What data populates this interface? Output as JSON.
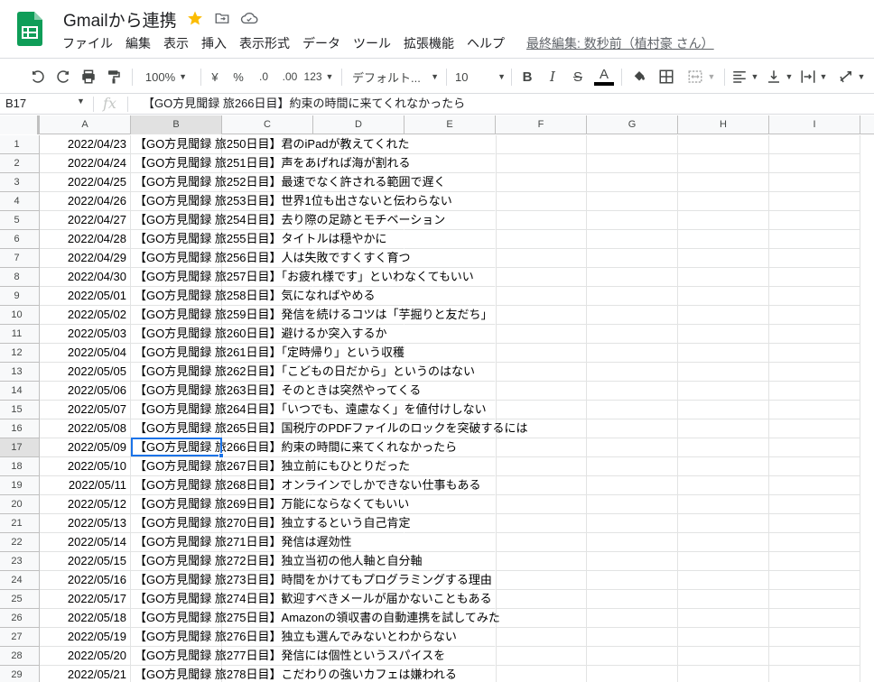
{
  "app": {
    "title": "Gmailから連携",
    "last_edit": "最終編集: 数秒前（植村豪 さん）",
    "brand_color": "#0f9d58"
  },
  "menu": [
    "ファイル",
    "編集",
    "表示",
    "挿入",
    "表示形式",
    "データ",
    "ツール",
    "拡張機能",
    "ヘルプ"
  ],
  "toolbar": {
    "zoom": "100%",
    "currency": "¥",
    "percent": "%",
    "decimal_decrease": ".0",
    "decimal_increase": ".00",
    "more_formats": "123",
    "font": "デフォルト...",
    "font_size": "10",
    "bold": "B",
    "italic": "I",
    "strikethrough": "S",
    "text_color_glyph": "A"
  },
  "formula_bar": {
    "cell_ref": "B17",
    "fx": "fx",
    "content": "【GO方見聞録 旅266日目】約束の時間に来てくれなかったら"
  },
  "columns": [
    "A",
    "B",
    "C",
    "D",
    "E",
    "F",
    "G",
    "H",
    "I"
  ],
  "selected_column": "B",
  "selected_row": 17,
  "rows": [
    {
      "n": "1",
      "a": "2022/04/23",
      "b": "【GO方見聞録 旅250日目】君のiPadが教えてくれた"
    },
    {
      "n": "2",
      "a": "2022/04/24",
      "b": "【GO方見聞録 旅251日目】声をあげれば海が割れる"
    },
    {
      "n": "3",
      "a": "2022/04/25",
      "b": "【GO方見聞録 旅252日目】最速でなく許される範囲で遅く"
    },
    {
      "n": "4",
      "a": "2022/04/26",
      "b": "【GO方見聞録 旅253日目】世界1位も出さないと伝わらない"
    },
    {
      "n": "5",
      "a": "2022/04/27",
      "b": "【GO方見聞録 旅254日目】去り際の足跡とモチベーション"
    },
    {
      "n": "6",
      "a": "2022/04/28",
      "b": "【GO方見聞録 旅255日目】タイトルは穏やかに"
    },
    {
      "n": "7",
      "a": "2022/04/29",
      "b": "【GO方見聞録 旅256日目】人は失敗ですくすく育つ"
    },
    {
      "n": "8",
      "a": "2022/04/30",
      "b": "【GO方見聞録 旅257日目】「お疲れ様です」といわなくてもいい"
    },
    {
      "n": "9",
      "a": "2022/05/01",
      "b": "【GO方見聞録 旅258日目】気になればやめる"
    },
    {
      "n": "10",
      "a": "2022/05/02",
      "b": "【GO方見聞録 旅259日目】発信を続けるコツは「芋掘りと友だち」"
    },
    {
      "n": "11",
      "a": "2022/05/03",
      "b": "【GO方見聞録 旅260日目】避けるか突入するか"
    },
    {
      "n": "12",
      "a": "2022/05/04",
      "b": "【GO方見聞録 旅261日目】「定時帰り」という収穫"
    },
    {
      "n": "13",
      "a": "2022/05/05",
      "b": "【GO方見聞録 旅262日目】「こどもの日だから」というのはない"
    },
    {
      "n": "14",
      "a": "2022/05/06",
      "b": "【GO方見聞録 旅263日目】そのときは突然やってくる"
    },
    {
      "n": "15",
      "a": "2022/05/07",
      "b": "【GO方見聞録 旅264日目】「いつでも、遠慮なく」を値付けしない"
    },
    {
      "n": "16",
      "a": "2022/05/08",
      "b": "【GO方見聞録 旅265日目】国税庁のPDFファイルのロックを突破するには"
    },
    {
      "n": "17",
      "a": "2022/05/09",
      "b": "【GO方見聞録 旅266日目】約束の時間に来てくれなかったら"
    },
    {
      "n": "18",
      "a": "2022/05/10",
      "b": "【GO方見聞録 旅267日目】独立前にもひとりだった"
    },
    {
      "n": "19",
      "a": "2022/05/11",
      "b": "【GO方見聞録 旅268日目】オンラインでしかできない仕事もある"
    },
    {
      "n": "20",
      "a": "2022/05/12",
      "b": "【GO方見聞録 旅269日目】万能にならなくてもいい"
    },
    {
      "n": "21",
      "a": "2022/05/13",
      "b": "【GO方見聞録 旅270日目】独立するという自己肯定"
    },
    {
      "n": "22",
      "a": "2022/05/14",
      "b": "【GO方見聞録 旅271日目】発信は遅効性"
    },
    {
      "n": "23",
      "a": "2022/05/15",
      "b": "【GO方見聞録 旅272日目】独立当初の他人軸と自分軸"
    },
    {
      "n": "24",
      "a": "2022/05/16",
      "b": "【GO方見聞録 旅273日目】時間をかけてもプログラミングする理由"
    },
    {
      "n": "25",
      "a": "2022/05/17",
      "b": "【GO方見聞録 旅274日目】歓迎すべきメールが届かないこともある"
    },
    {
      "n": "26",
      "a": "2022/05/18",
      "b": "【GO方見聞録 旅275日目】Amazonの領収書の自動連携を試してみた"
    },
    {
      "n": "27",
      "a": "2022/05/19",
      "b": "【GO方見聞録 旅276日目】独立も選んでみないとわからない"
    },
    {
      "n": "28",
      "a": "2022/05/20",
      "b": "【GO方見聞録 旅277日目】発信には個性というスパイスを"
    },
    {
      "n": "29",
      "a": "2022/05/21",
      "b": "【GO方見聞録 旅278日目】こだわりの強いカフェは嫌われる"
    }
  ]
}
